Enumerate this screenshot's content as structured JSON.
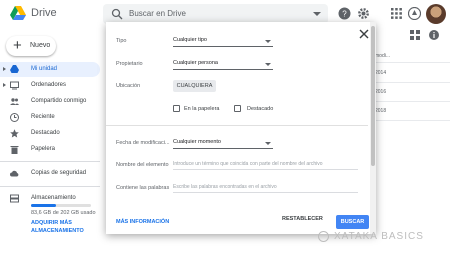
{
  "app": {
    "title": "Drive",
    "accent": "#1a73e8"
  },
  "search": {
    "placeholder": "Buscar en Drive"
  },
  "header_icons": [
    "help-icon",
    "settings-icon",
    "apps-icon",
    "notifications-icon",
    "avatar"
  ],
  "sidebar": {
    "new_label": "Nuevo",
    "items": [
      {
        "label": "Mi unidad",
        "icon": "drive-icon",
        "active": true
      },
      {
        "label": "Ordenadores",
        "icon": "computer-icon"
      },
      {
        "label": "Compartido conmigo",
        "icon": "people-icon"
      },
      {
        "label": "Reciente",
        "icon": "clock-icon"
      },
      {
        "label": "Destacado",
        "icon": "star-icon"
      },
      {
        "label": "Papelera",
        "icon": "trash-icon"
      },
      {
        "label": "Copias de seguridad",
        "icon": "cloud-icon"
      }
    ],
    "storage": {
      "title": "Almacenamiento",
      "used": "83,6 GB de 202 GB usado",
      "used_fraction": 0.41,
      "upgrade": "ADQUIRIR MÁS ALMACENAMIENTO"
    }
  },
  "background": {
    "col_header": "modi...",
    "rows": [
      "2014",
      "2016",
      "2018"
    ]
  },
  "dialog": {
    "tipo_label": "Tipo",
    "tipo_value": "Cualquier tipo",
    "propietario_label": "Propietario",
    "propietario_value": "Cualquier persona",
    "ubicacion_label": "Ubicación",
    "ubicacion_button": "CUALQUIERA",
    "papelera_label": "En la papelera",
    "destacado_label": "Destacado",
    "fecha_label": "Fecha de modificaci...",
    "fecha_value": "Cualquier momento",
    "nombre_label": "Nombre del elemento",
    "nombre_placeholder": "Introduce un término que coincida con parte del nombre del archivo",
    "contiene_label": "Contiene las palabras",
    "contiene_placeholder": "Escribe las palabras encontradas en el archivo",
    "more_info": "MÁS INFORMACIÓN",
    "reset": "RESTABLECER",
    "search": "BUSCAR",
    "search_color": "#4285f4"
  },
  "watermark": {
    "text": "XATAKA BASICS"
  }
}
